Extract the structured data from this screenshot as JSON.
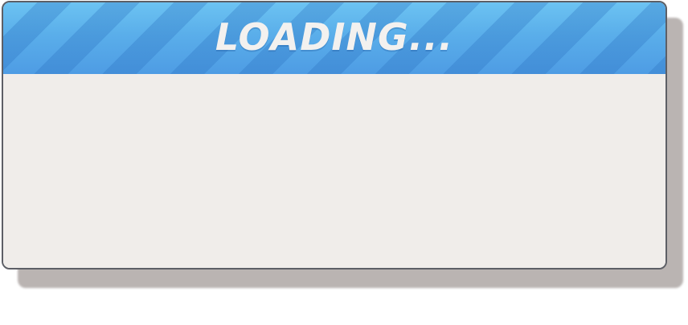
{
  "dialog": {
    "title": "LOADING..."
  },
  "colors": {
    "header_top": "#6cc3f2",
    "header_bottom": "#4e9ce4",
    "stripe": "#3f8cd8",
    "title_text": "#f3f1ef",
    "body_background": "#f0edea",
    "border": "#5d5f66",
    "shadow": "#bab4b2"
  }
}
